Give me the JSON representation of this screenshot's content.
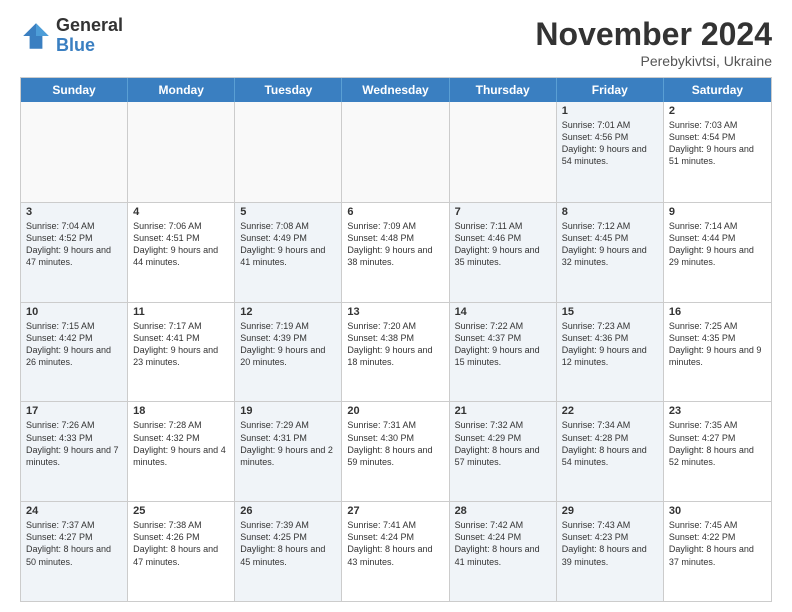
{
  "logo": {
    "text_general": "General",
    "text_blue": "Blue"
  },
  "header": {
    "month": "November 2024",
    "location": "Perebykivtsi, Ukraine"
  },
  "weekdays": [
    "Sunday",
    "Monday",
    "Tuesday",
    "Wednesday",
    "Thursday",
    "Friday",
    "Saturday"
  ],
  "rows": [
    [
      {
        "day": "",
        "info": "",
        "empty": true
      },
      {
        "day": "",
        "info": "",
        "empty": true
      },
      {
        "day": "",
        "info": "",
        "empty": true
      },
      {
        "day": "",
        "info": "",
        "empty": true
      },
      {
        "day": "",
        "info": "",
        "empty": true
      },
      {
        "day": "1",
        "info": "Sunrise: 7:01 AM\nSunset: 4:56 PM\nDaylight: 9 hours and 54 minutes.",
        "shaded": true
      },
      {
        "day": "2",
        "info": "Sunrise: 7:03 AM\nSunset: 4:54 PM\nDaylight: 9 hours and 51 minutes.",
        "shaded": false
      }
    ],
    [
      {
        "day": "3",
        "info": "Sunrise: 7:04 AM\nSunset: 4:52 PM\nDaylight: 9 hours and 47 minutes.",
        "shaded": true
      },
      {
        "day": "4",
        "info": "Sunrise: 7:06 AM\nSunset: 4:51 PM\nDaylight: 9 hours and 44 minutes.",
        "shaded": false
      },
      {
        "day": "5",
        "info": "Sunrise: 7:08 AM\nSunset: 4:49 PM\nDaylight: 9 hours and 41 minutes.",
        "shaded": true
      },
      {
        "day": "6",
        "info": "Sunrise: 7:09 AM\nSunset: 4:48 PM\nDaylight: 9 hours and 38 minutes.",
        "shaded": false
      },
      {
        "day": "7",
        "info": "Sunrise: 7:11 AM\nSunset: 4:46 PM\nDaylight: 9 hours and 35 minutes.",
        "shaded": true
      },
      {
        "day": "8",
        "info": "Sunrise: 7:12 AM\nSunset: 4:45 PM\nDaylight: 9 hours and 32 minutes.",
        "shaded": true
      },
      {
        "day": "9",
        "info": "Sunrise: 7:14 AM\nSunset: 4:44 PM\nDaylight: 9 hours and 29 minutes.",
        "shaded": false
      }
    ],
    [
      {
        "day": "10",
        "info": "Sunrise: 7:15 AM\nSunset: 4:42 PM\nDaylight: 9 hours and 26 minutes.",
        "shaded": true
      },
      {
        "day": "11",
        "info": "Sunrise: 7:17 AM\nSunset: 4:41 PM\nDaylight: 9 hours and 23 minutes.",
        "shaded": false
      },
      {
        "day": "12",
        "info": "Sunrise: 7:19 AM\nSunset: 4:39 PM\nDaylight: 9 hours and 20 minutes.",
        "shaded": true
      },
      {
        "day": "13",
        "info": "Sunrise: 7:20 AM\nSunset: 4:38 PM\nDaylight: 9 hours and 18 minutes.",
        "shaded": false
      },
      {
        "day": "14",
        "info": "Sunrise: 7:22 AM\nSunset: 4:37 PM\nDaylight: 9 hours and 15 minutes.",
        "shaded": true
      },
      {
        "day": "15",
        "info": "Sunrise: 7:23 AM\nSunset: 4:36 PM\nDaylight: 9 hours and 12 minutes.",
        "shaded": true
      },
      {
        "day": "16",
        "info": "Sunrise: 7:25 AM\nSunset: 4:35 PM\nDaylight: 9 hours and 9 minutes.",
        "shaded": false
      }
    ],
    [
      {
        "day": "17",
        "info": "Sunrise: 7:26 AM\nSunset: 4:33 PM\nDaylight: 9 hours and 7 minutes.",
        "shaded": true
      },
      {
        "day": "18",
        "info": "Sunrise: 7:28 AM\nSunset: 4:32 PM\nDaylight: 9 hours and 4 minutes.",
        "shaded": false
      },
      {
        "day": "19",
        "info": "Sunrise: 7:29 AM\nSunset: 4:31 PM\nDaylight: 9 hours and 2 minutes.",
        "shaded": true
      },
      {
        "day": "20",
        "info": "Sunrise: 7:31 AM\nSunset: 4:30 PM\nDaylight: 8 hours and 59 minutes.",
        "shaded": false
      },
      {
        "day": "21",
        "info": "Sunrise: 7:32 AM\nSunset: 4:29 PM\nDaylight: 8 hours and 57 minutes.",
        "shaded": true
      },
      {
        "day": "22",
        "info": "Sunrise: 7:34 AM\nSunset: 4:28 PM\nDaylight: 8 hours and 54 minutes.",
        "shaded": true
      },
      {
        "day": "23",
        "info": "Sunrise: 7:35 AM\nSunset: 4:27 PM\nDaylight: 8 hours and 52 minutes.",
        "shaded": false
      }
    ],
    [
      {
        "day": "24",
        "info": "Sunrise: 7:37 AM\nSunset: 4:27 PM\nDaylight: 8 hours and 50 minutes.",
        "shaded": true
      },
      {
        "day": "25",
        "info": "Sunrise: 7:38 AM\nSunset: 4:26 PM\nDaylight: 8 hours and 47 minutes.",
        "shaded": false
      },
      {
        "day": "26",
        "info": "Sunrise: 7:39 AM\nSunset: 4:25 PM\nDaylight: 8 hours and 45 minutes.",
        "shaded": true
      },
      {
        "day": "27",
        "info": "Sunrise: 7:41 AM\nSunset: 4:24 PM\nDaylight: 8 hours and 43 minutes.",
        "shaded": false
      },
      {
        "day": "28",
        "info": "Sunrise: 7:42 AM\nSunset: 4:24 PM\nDaylight: 8 hours and 41 minutes.",
        "shaded": true
      },
      {
        "day": "29",
        "info": "Sunrise: 7:43 AM\nSunset: 4:23 PM\nDaylight: 8 hours and 39 minutes.",
        "shaded": true
      },
      {
        "day": "30",
        "info": "Sunrise: 7:45 AM\nSunset: 4:22 PM\nDaylight: 8 hours and 37 minutes.",
        "shaded": false
      }
    ]
  ]
}
